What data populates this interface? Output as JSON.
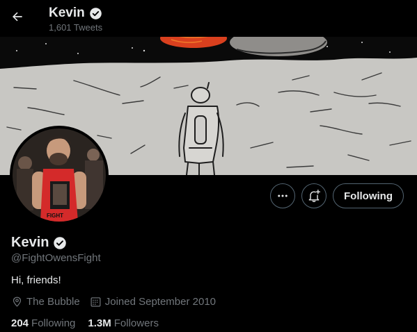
{
  "header": {
    "name": "Kevin",
    "tweet_count": "1,601 Tweets"
  },
  "actions": {
    "follow_label": "Following"
  },
  "profile": {
    "name": "Kevin",
    "handle": "@FightOwensFight",
    "bio": "Hi, friends!",
    "location": "The Bubble",
    "joined": "Joined September 2010",
    "following_count": "204",
    "following_label": "Following",
    "followers_count": "1.3M",
    "followers_label": "Followers"
  },
  "colors": {
    "background": "#000000",
    "text_primary": "#e7e9ea",
    "text_secondary": "#71767b",
    "border": "#536471"
  },
  "icons": {
    "back": "arrow-left-icon",
    "verified": "verified-badge-icon",
    "more": "more-dots-icon",
    "notifications": "bell-plus-icon",
    "location": "location-pin-icon",
    "calendar": "calendar-icon"
  }
}
